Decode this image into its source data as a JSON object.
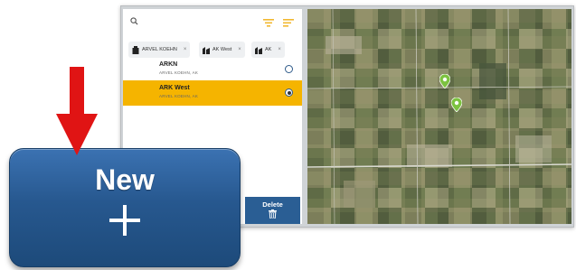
{
  "search": {
    "icon": "search-icon"
  },
  "filters": [
    {
      "icon": "filter-lines-icon",
      "color": "#f2b830"
    },
    {
      "icon": "sort-icon",
      "color": "#f2b830"
    }
  ],
  "chips": [
    {
      "label": "ARVEL KOEHN",
      "icon": "owner-icon"
    },
    {
      "label": "AK West",
      "icon": "farm-icon"
    },
    {
      "label": "AK",
      "icon": "farm-icon"
    }
  ],
  "list": [
    {
      "title": "ARKN",
      "subtitle": "ARVEL KOEHN, AK",
      "selected": false
    },
    {
      "title": "ARK West",
      "subtitle": "ARVEL KOEHN, AK",
      "selected": true
    }
  ],
  "colors": {
    "selected_row": "#f5b400",
    "primary_blue": "#2a5e94",
    "arrow_red": "#e01414",
    "pin_green": "#7cc240"
  },
  "delete_button": {
    "label": "Delete",
    "icon": "trash-icon"
  },
  "new_button": {
    "label": "New",
    "icon": "plus-icon"
  },
  "map": {
    "pins": 2,
    "pin_icon": "map-pin-icon"
  },
  "callout": {
    "icon": "arrow-down-icon"
  }
}
